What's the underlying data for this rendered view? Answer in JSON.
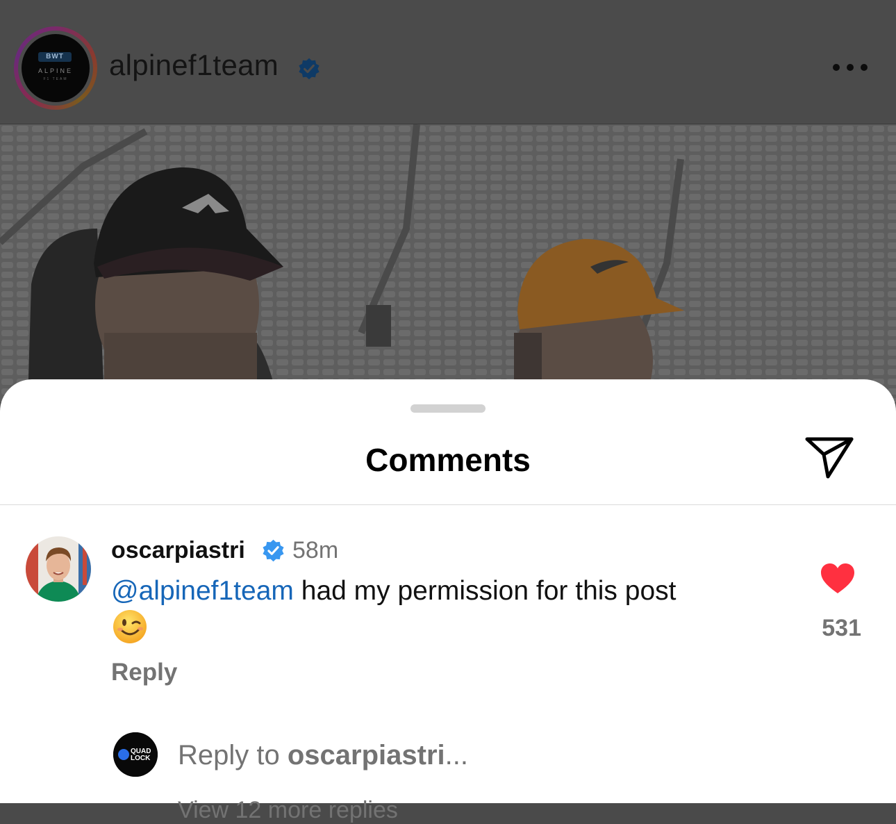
{
  "post": {
    "account_name": "alpinef1team",
    "avatar_logo_top": "BWT",
    "avatar_logo_mid": "ALPINE",
    "avatar_logo_bottom": "F1 TEAM",
    "more_icon": "more-dots-icon"
  },
  "comments_sheet": {
    "title": "Comments",
    "share_icon": "paper-plane-icon",
    "comment": {
      "username": "oscarpiastri",
      "verified_icon": "verified-badge-icon",
      "time": "58m",
      "mention": "@alpinef1team",
      "text": " had my permission for this post",
      "emoji_icon": "winking-face-icon",
      "like_icon": "heart-filled-icon",
      "like_count": "531",
      "reply_label": "Reply"
    },
    "reply_box": {
      "prefix": "Reply to ",
      "target": "oscarpiastri",
      "suffix": "...",
      "avatar_logo_top": "QUAD",
      "avatar_logo_bottom": "LOCK"
    },
    "view_replies": "View 12 more replies"
  },
  "colors": {
    "accent_blue": "#1666b8",
    "verified_blue": "#3897f0",
    "like_red": "#ff3040",
    "secondary_text": "#737373"
  }
}
